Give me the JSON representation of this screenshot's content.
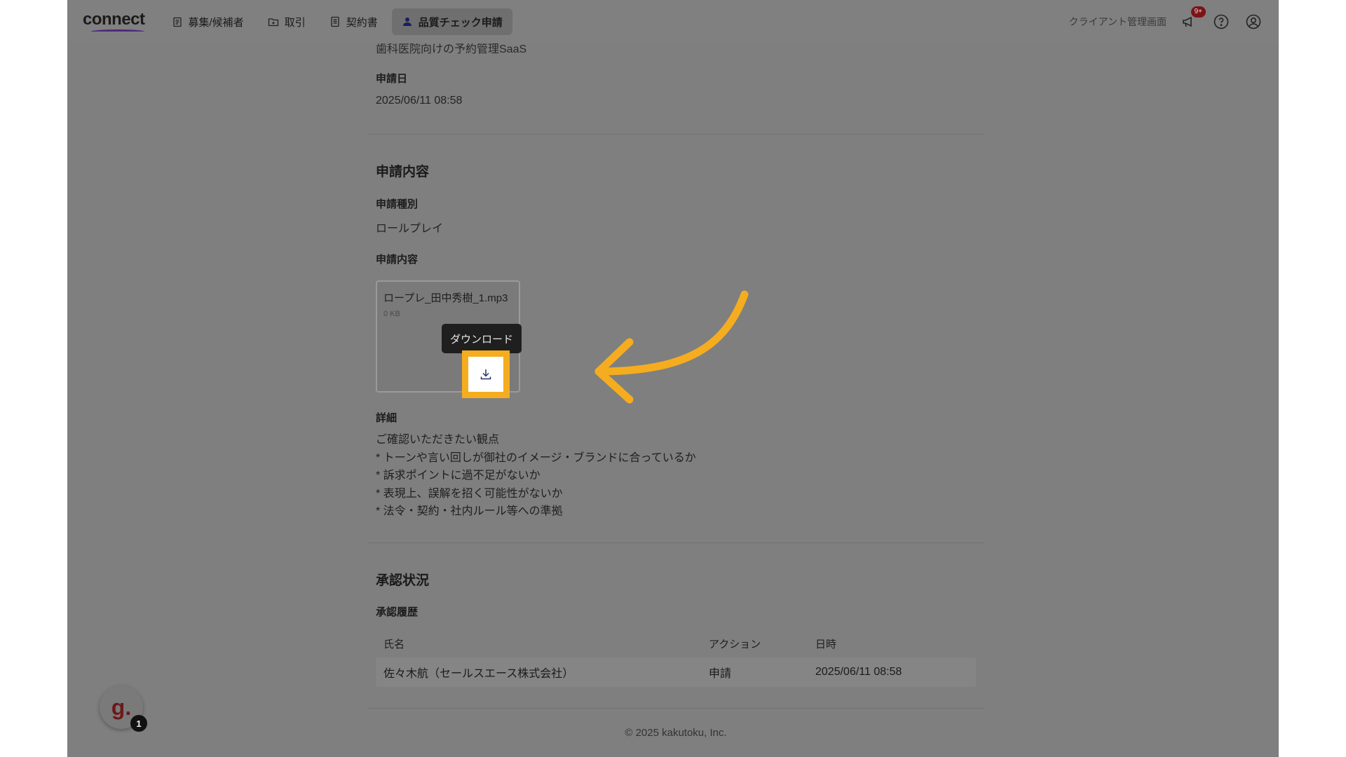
{
  "header": {
    "logo": "connect",
    "tabs": [
      {
        "label": "募集/候補者",
        "icon": "clipboard-icon"
      },
      {
        "label": "取引",
        "icon": "folder-icon"
      },
      {
        "label": "契約書",
        "icon": "document-icon"
      },
      {
        "label": "品質チェック申請",
        "icon": "user-icon",
        "active": true
      }
    ],
    "client_link": "クライアント管理画面",
    "notification_badge": "9+"
  },
  "top_cut_text": "歯科医院向けの予約管理SaaS",
  "application_date": {
    "label": "申請日",
    "value": "2025/06/11 08:58"
  },
  "section_content": {
    "title": "申請内容",
    "type_label": "申請種別",
    "type_value": "ロールプレイ",
    "content_label": "申請内容",
    "file": {
      "name": "ロープレ_田中秀樹_1.mp3",
      "size": "0 KB"
    },
    "tooltip": "ダウンロード",
    "detail_label": "詳細",
    "detail_lines": [
      "ご確認いただきたい観点",
      "* トーンや言い回しが御社のイメージ・ブランドに合っているか",
      "* 訴求ポイントに過不足がないか",
      "* 表現上、誤解を招く可能性がないか",
      "* 法令・契約・社内ルール等への準拠"
    ]
  },
  "section_status": {
    "title": "承認状況",
    "history_label": "承認履歴",
    "columns": [
      "氏名",
      "アクション",
      "日時"
    ],
    "rows": [
      {
        "name": "佐々木航（セールスエース株式会社）",
        "action": "申請",
        "date": "2025/06/11 08:58"
      }
    ]
  },
  "footer": {
    "copyright": "© 2025 kakutoku, Inc."
  },
  "widget": {
    "letter": "g.",
    "badge": "1"
  },
  "colors": {
    "highlight": "#f5ad1f",
    "overlay": "#7f7f7f",
    "badge": "#7c1416"
  }
}
